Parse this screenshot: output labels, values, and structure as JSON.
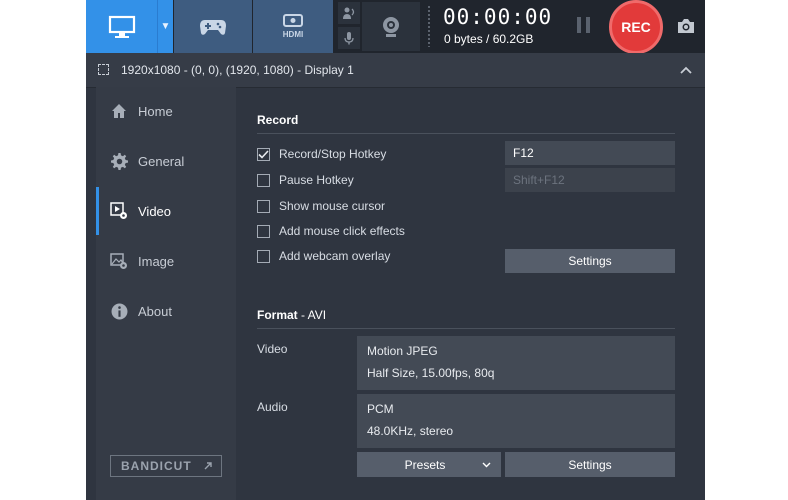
{
  "toolbar": {
    "modes": [
      {
        "name": "screen-mode",
        "icon": "monitor-icon"
      },
      {
        "name": "game-mode",
        "icon": "gamepad-icon"
      },
      {
        "name": "device-mode",
        "icon": "hdmi-icon",
        "label": "HDMI"
      }
    ],
    "timer": "00:00:00",
    "size": "0 bytes / 60.2GB",
    "rec_label": "REC",
    "accent": "#3391e8",
    "rec_color": "#e23a3a"
  },
  "display_bar": {
    "text": "1920x1080 - (0, 0), (1920, 1080) - Display 1"
  },
  "sidebar": {
    "items": [
      {
        "label": "Home",
        "icon": "home-icon"
      },
      {
        "label": "General",
        "icon": "gear-icon"
      },
      {
        "label": "Video",
        "icon": "video-settings-icon",
        "active": true
      },
      {
        "label": "Image",
        "icon": "image-icon"
      },
      {
        "label": "About",
        "icon": "info-icon"
      }
    ],
    "bandicut": "BANDICUT"
  },
  "record": {
    "title": "Record",
    "options": [
      {
        "label": "Record/Stop Hotkey",
        "checked": true
      },
      {
        "label": "Pause Hotkey",
        "checked": false
      },
      {
        "label": "Show mouse cursor",
        "checked": false
      },
      {
        "label": "Add mouse click effects",
        "checked": false
      },
      {
        "label": "Add webcam overlay",
        "checked": false
      }
    ],
    "record_hotkey": "F12",
    "pause_hotkey": "Shift+F12",
    "settings_label": "Settings"
  },
  "format": {
    "title": "Format",
    "container": "- AVI",
    "video_label": "Video",
    "video_codec": "Motion JPEG",
    "video_details": "Half Size, 15.00fps, 80q",
    "audio_label": "Audio",
    "audio_codec": "PCM",
    "audio_details": "48.0KHz, stereo",
    "presets_label": "Presets",
    "settings_label": "Settings"
  }
}
